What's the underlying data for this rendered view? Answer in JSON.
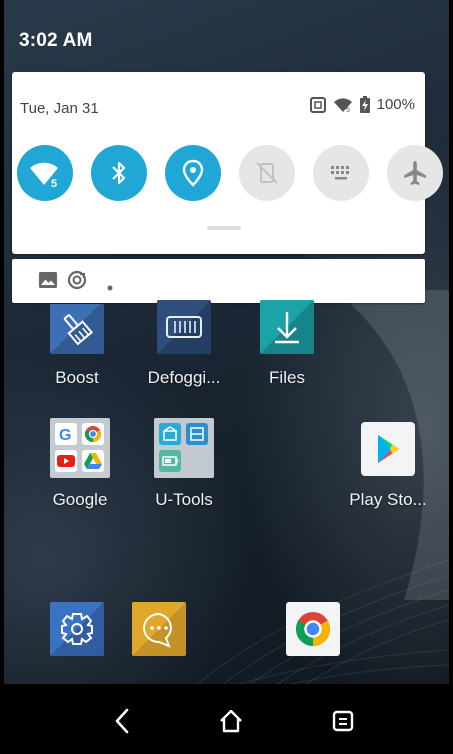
{
  "status_bar": {
    "time": "3:02 AM"
  },
  "quick_settings": {
    "date": "Tue, Jan 31",
    "battery_percent": "100%",
    "wifi_badge": "5",
    "tiles": [
      {
        "name": "wifi",
        "state": "on"
      },
      {
        "name": "bluetooth",
        "state": "on"
      },
      {
        "name": "location",
        "state": "on"
      },
      {
        "name": "auto-rotate",
        "state": "off"
      },
      {
        "name": "keyboard",
        "state": "off"
      },
      {
        "name": "airplane-mode",
        "state": "off"
      }
    ]
  },
  "notifications": {
    "icons": [
      "gallery-icon",
      "sync-icon",
      "more-dot"
    ]
  },
  "home_screen": {
    "apps": [
      {
        "label": "Boost"
      },
      {
        "label": "Defoggi..."
      },
      {
        "label": "Files"
      },
      {
        "label": "Google"
      },
      {
        "label": "U-Tools"
      },
      {
        "label": "Play Sto..."
      }
    ],
    "dock": [
      "settings-icon",
      "messages-icon",
      "chrome-icon"
    ]
  },
  "colors": {
    "accent": "#20a7d6",
    "tile_off": "#e6e6e6",
    "panel_bg": "#ffffff",
    "boost_blue": "#3c6fb3",
    "files_teal": "#1ba3a8",
    "messages_yellow": "#e0a72c",
    "settings_blue": "#3a72c4"
  }
}
